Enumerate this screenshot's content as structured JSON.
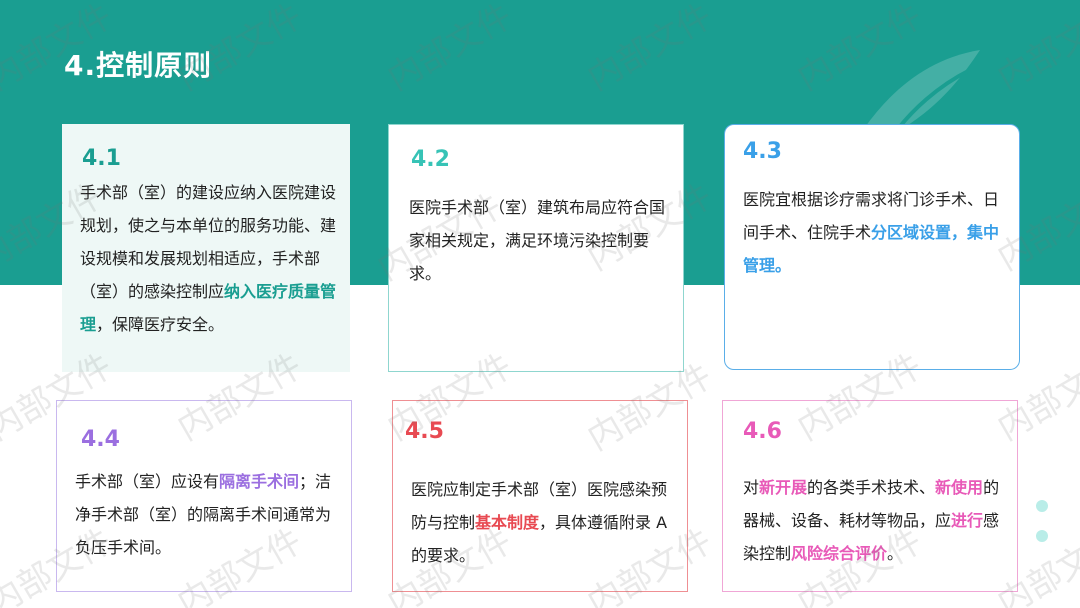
{
  "slide": {
    "title": "4.控制原则",
    "watermark": "内部文件",
    "colors": {
      "teal_band": "#1a9e91",
      "teal": "#1a9e91",
      "blue": "#3aa0e8",
      "purple": "#9b6fe0",
      "red": "#e84a52",
      "pink": "#e85ab8"
    }
  },
  "cards": {
    "c1": {
      "num": "4.1",
      "t1": "手术部（室）的建设应纳入医院建设规划，使之与本单位的服务功能、建设规模和发展规划相适应，手术部（室）的感染控制应",
      "hl1": "纳入医疗质量管理",
      "t2": "，保障医疗安全。"
    },
    "c2": {
      "num": "4.2",
      "t1": "医院手术部（室）建筑布局应符合国家相关规定，满足环境污染控制要求。"
    },
    "c3": {
      "num": "4.3",
      "t1": "医院宜根据诊疗需求将门诊手术、日间手术、住院手术",
      "hl1": "分区域设置，集中管理。"
    },
    "c4": {
      "num": "4.4",
      "t1": "手术部（室）应设有",
      "hl1": "隔离手术间",
      "t2": "；洁净手术部（室）的隔离手术间通常为负压手术间。"
    },
    "c5": {
      "num": "4.5",
      "t1": "医院应制定手术部（室）医院感染预防与控制",
      "hl1": "基本制度",
      "t2": "，具体遵循附录 A 的要求。"
    },
    "c6": {
      "num": "4.6",
      "t1": "对",
      "hl1": "新开展",
      "t2": "的各类手术技术、",
      "hl2": "新使用",
      "t3": "的器械、设备、耗材等物品，应",
      "hl3": "进行",
      "t4": "感染控制",
      "hl4": "风险综合评价",
      "t5": "。"
    }
  }
}
